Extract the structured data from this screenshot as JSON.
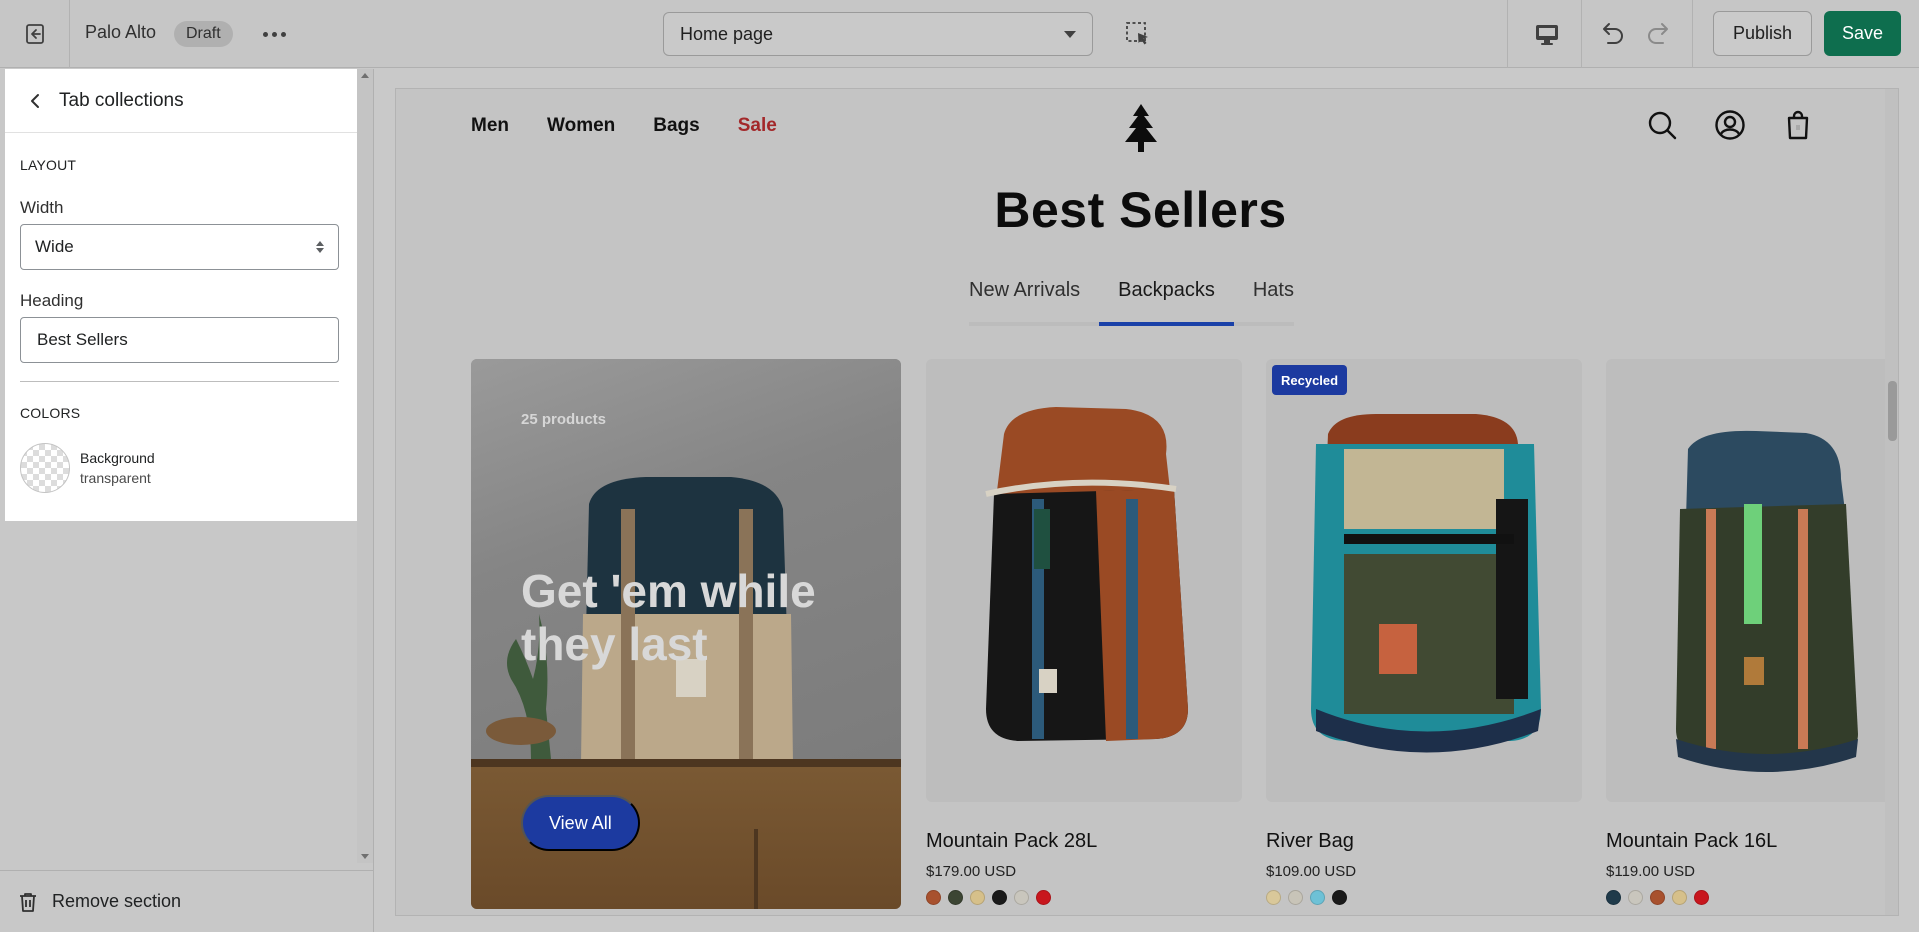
{
  "topbar": {
    "store_name": "Palo Alto",
    "status_badge": "Draft",
    "page_select": "Home page",
    "publish_label": "Publish",
    "save_label": "Save",
    "save_color": "#0e6e4e"
  },
  "sidebar": {
    "title": "Tab collections",
    "layout_heading": "LAYOUT",
    "width_label": "Width",
    "width_value": "Wide",
    "heading_label": "Heading",
    "heading_value": "Best Sellers",
    "colors_heading": "COLORS",
    "background_label": "Background",
    "background_value": "transparent",
    "remove_label": "Remove section"
  },
  "preview": {
    "nav": [
      "Men",
      "Women",
      "Bags",
      "Sale"
    ],
    "section_title": "Best Sellers",
    "tabs": [
      "New Arrivals",
      "Backpacks",
      "Hats"
    ],
    "active_tab": "Backpacks",
    "hero": {
      "count": "25 products",
      "heading": "Get 'em while they last",
      "button": "View All"
    },
    "products": [
      {
        "name": "Mountain Pack 28L",
        "price": "$179.00 USD",
        "badge": "",
        "swatches": [
          "#a8512e",
          "#3c4533",
          "#d6c08a",
          "#1a1a1a",
          "#c9c6bd",
          "#c8161d"
        ]
      },
      {
        "name": "River Bag",
        "price": "$109.00 USD",
        "badge": "Recycled",
        "swatches": [
          "#d9c89a",
          "#c8c4b8",
          "#6ec1d6",
          "#1a1a1a"
        ]
      },
      {
        "name": "Mountain Pack 16L",
        "price": "$119.00 USD",
        "badge": "",
        "swatches": [
          "#1f3a4a",
          "#c9c6bd",
          "#a8512e",
          "#d6c08a",
          "#c8161d"
        ]
      }
    ],
    "accent_color": "#1c3aa0"
  }
}
